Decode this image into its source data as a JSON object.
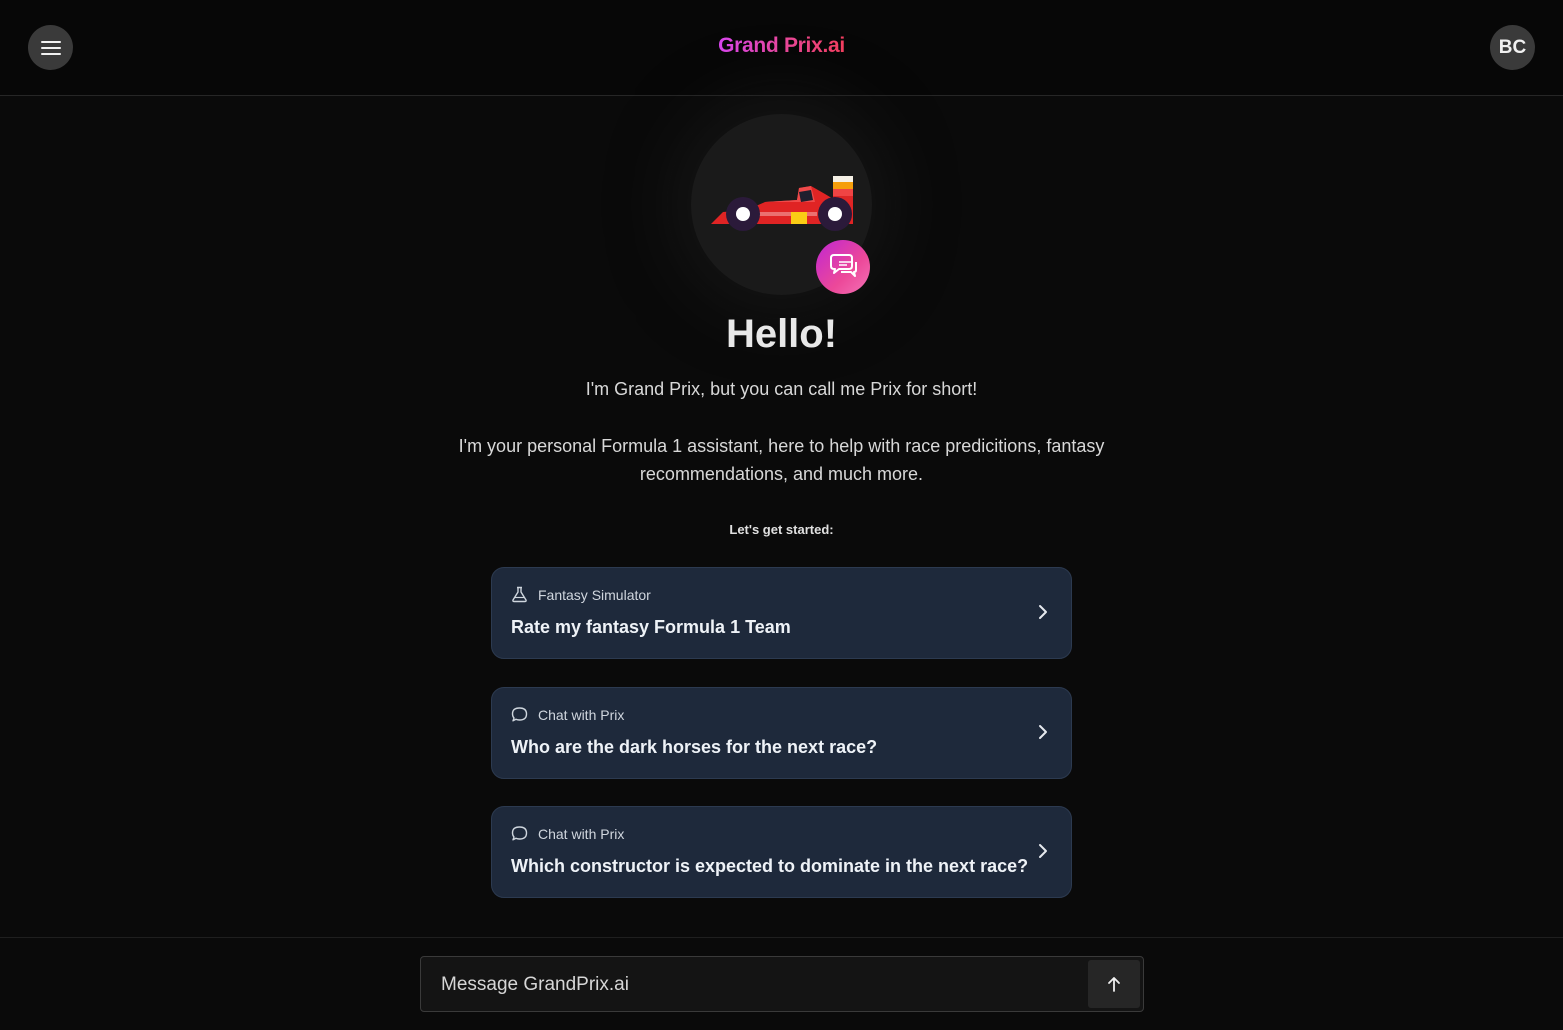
{
  "header": {
    "brand": "Grand Prix.ai",
    "avatar_initials": "BC",
    "menu_icon": "hamburger-menu-icon"
  },
  "hero": {
    "illustration": "race-car-icon",
    "badge_icon": "chat-bubbles-icon",
    "greeting": "Hello!",
    "intro": "I'm Grand Prix, but you can call me Prix for short!",
    "description": "I'm your personal Formula 1 assistant, here to help with race predicitions, fantasy recommendations, and much more.",
    "prompt_heading": "Let's get started:"
  },
  "suggestions": [
    {
      "category": "Fantasy Simulator",
      "icon": "flask-icon",
      "question": "Rate my fantasy Formula 1 Team"
    },
    {
      "category": "Chat with Prix",
      "icon": "chat-bubble-icon",
      "question": "Who are the dark horses for the next race?"
    },
    {
      "category": "Chat with Prix",
      "icon": "chat-bubble-icon",
      "question": "Which constructor is expected to dominate in the next race?"
    }
  ],
  "composer": {
    "placeholder": "Message GrandPrix.ai",
    "value": "",
    "send_icon": "arrow-up-icon"
  },
  "colors": {
    "background": "#0a0a0a",
    "card": "#1e293b",
    "brand_gradient_start": "#d946ef",
    "brand_gradient_end": "#f43f5e"
  }
}
